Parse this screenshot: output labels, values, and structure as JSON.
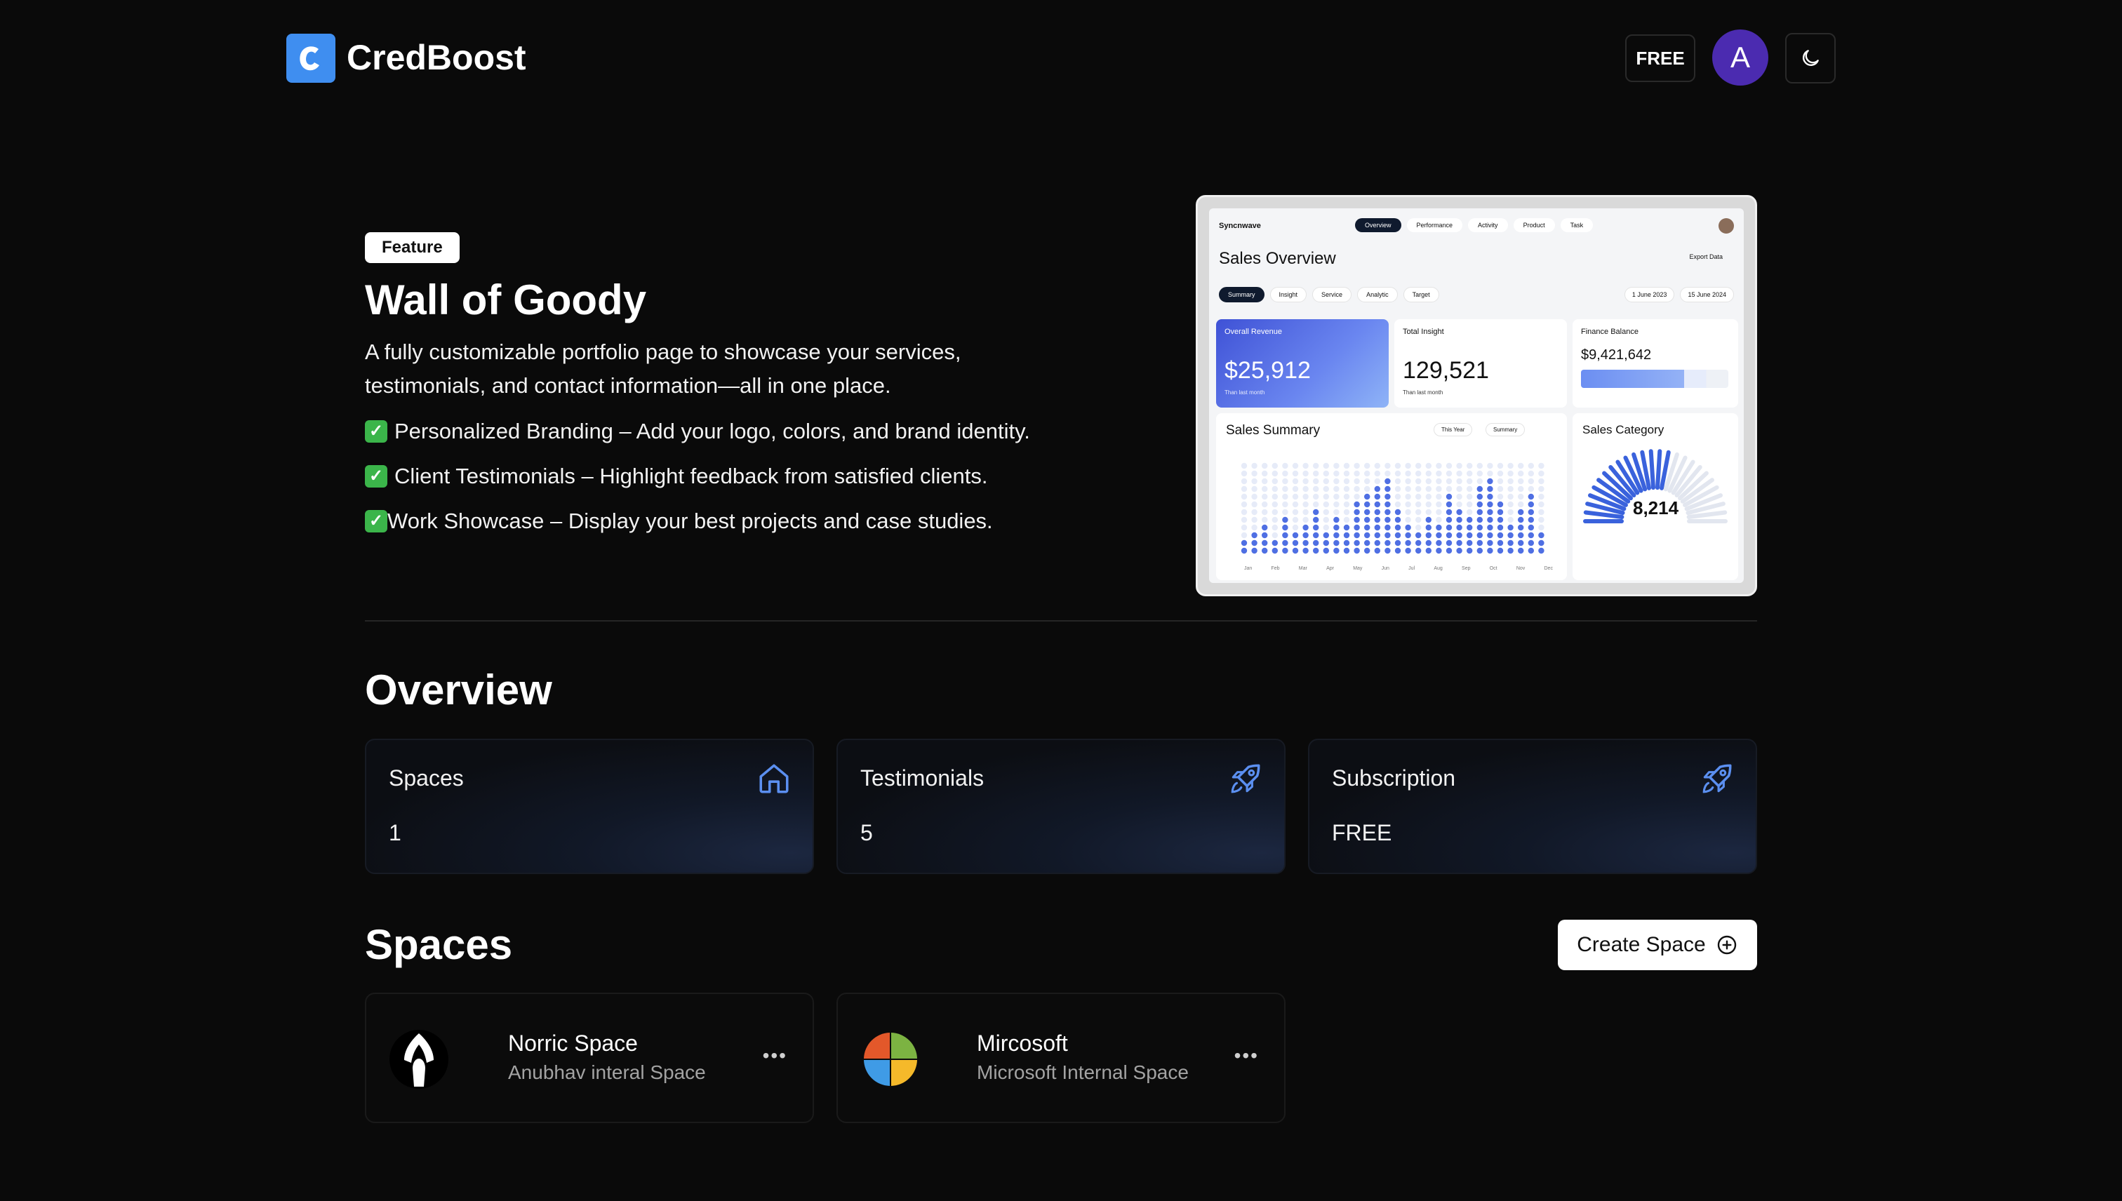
{
  "header": {
    "brand": "CredBoost",
    "plan_badge": "FREE",
    "avatar_initial": "A"
  },
  "hero": {
    "badge": "Feature",
    "title": "Wall of Goody",
    "description": "A fully customizable portfolio page to showcase your services, testimonials, and contact information—all in one place.",
    "bullets": [
      "Personalized Branding – Add your logo, colors, and brand identity.",
      "Client Testimonials – Highlight feedback from satisfied clients.",
      "Work Showcase – Display your best projects and case studies."
    ],
    "preview": {
      "logo": "Syncnwave",
      "tabs": [
        "Overview",
        "Performance",
        "Activity",
        "Product",
        "Task"
      ],
      "title": "Sales Overview",
      "export": "Export Data",
      "subtabs": [
        "Summary",
        "Insight",
        "Service",
        "Analytic",
        "Target"
      ],
      "dates": [
        "1 June 2023",
        "15 June 2024"
      ],
      "cards": {
        "revenue_label": "Overall Revenue",
        "revenue_value": "$25,912",
        "insight_label": "Total Insight",
        "insight_value": "129,521",
        "balance_label": "Finance Balance",
        "balance_value": "$9,421,642",
        "compare": "Than last month"
      },
      "summary_title": "Sales Summary",
      "summary_filters": [
        "This Year",
        "Summary"
      ],
      "category_title": "Sales Category",
      "category_value": "8,214",
      "months": [
        "Jan",
        "Feb",
        "Mar",
        "Apr",
        "May",
        "Jun",
        "Jul",
        "Aug",
        "Sep",
        "Oct",
        "Nov",
        "Dec"
      ]
    }
  },
  "overview": {
    "title": "Overview",
    "cards": [
      {
        "label": "Spaces",
        "value": "1",
        "icon": "home-icon"
      },
      {
        "label": "Testimonials",
        "value": "5",
        "icon": "rocket-icon"
      },
      {
        "label": "Subscription",
        "value": "FREE",
        "icon": "rocket-icon"
      }
    ]
  },
  "spaces": {
    "title": "Spaces",
    "create_label": "Create Space",
    "items": [
      {
        "name": "Norric Space",
        "subtitle": "Anubhav interal Space"
      },
      {
        "name": "Mircosoft",
        "subtitle": "Microsoft Internal Space"
      }
    ]
  },
  "colors": {
    "background": "#0a0a0a",
    "brand_blue": "#3f8ef0",
    "avatar": "#4b2bb0",
    "icon_blue": "#5b8ff0"
  }
}
